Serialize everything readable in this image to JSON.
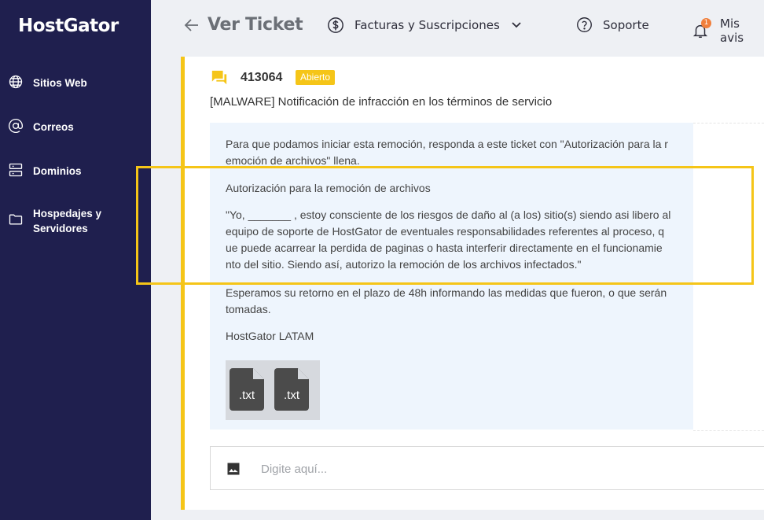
{
  "sidebar": {
    "logo": "HostGator",
    "items": [
      {
        "label": "Sitios Web",
        "icon": "globe-icon"
      },
      {
        "label": "Correos",
        "icon": "at-sign-icon"
      },
      {
        "label": "Dominios",
        "icon": "server-icon"
      },
      {
        "label": "Hospedajes y Servidores",
        "icon": "folder-icon"
      }
    ]
  },
  "header": {
    "back_icon": "arrow-left-icon",
    "title": "Ver Ticket",
    "billing_label": "Facturas y Suscripciones",
    "support_label": "Soporte",
    "notifications_label": "Mis avis",
    "notification_count": "1"
  },
  "ticket": {
    "id": "413064",
    "status": "Abierto",
    "title": "[MALWARE] Notificación de infracción en los términos de servicio",
    "paragraphs": [
      "Para que podamos iniciar esta remoción, responda a este ticket con \"Autorización para la r emoción de archivos\" llena.",
      "Autorización para la remoción de archivos",
      "\"Yo, _______ , estoy consciente de los riesgos de daño al (a los) sitio(s) siendo asi libero al equipo de soporte de HostGator de eventuales responsabilidades referentes al proceso, q ue puede acarrear la perdida de paginas o hasta interferir directamente en el funcionamie nto del sitio. Siendo así, autorizo la remoción de los archivos infectados.\"",
      "Esperamos su retorno en el plazo de 48h informando las medidas que fueron, o que serán tomadas.",
      "HostGator LATAM"
    ],
    "attachments": [
      ".txt",
      ".txt"
    ]
  },
  "reply": {
    "placeholder": "Digite aquí..."
  },
  "colors": {
    "sidebar_bg": "#1f1f4e",
    "accent": "#f5c518",
    "message_bg": "#eef5fd"
  }
}
